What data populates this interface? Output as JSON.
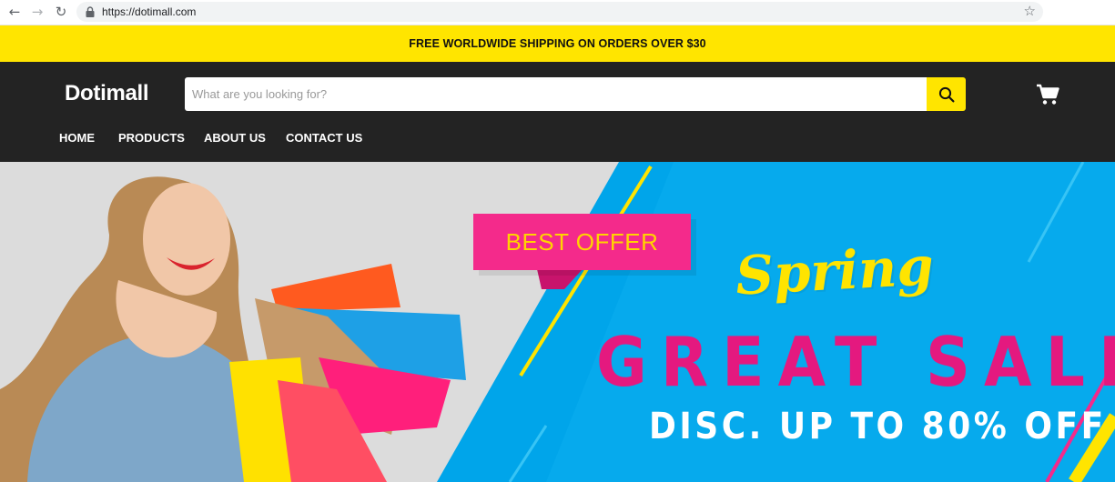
{
  "browser": {
    "url": "https://dotimall.com",
    "back_icon": "arrow-left-icon",
    "forward_icon": "arrow-right-icon",
    "reload_icon": "reload-icon",
    "lock_icon": "lock-icon",
    "star_icon": "star-icon"
  },
  "announcement": {
    "text": "FREE WORLDWIDE SHIPPING ON ORDERS OVER $30",
    "background": "#ffe500"
  },
  "header": {
    "logo": "Dotimall",
    "background": "#232323",
    "search": {
      "placeholder": "What are you looking for?",
      "value": "",
      "button_icon": "search-icon"
    },
    "cart_icon": "cart-icon"
  },
  "nav": {
    "items": [
      {
        "label": "HOME"
      },
      {
        "label": "PRODUCTS"
      },
      {
        "label": "ABOUT US"
      },
      {
        "label": "CONTACT US"
      }
    ]
  },
  "hero": {
    "badge": "BEST OFFER",
    "headline_script": "Spring",
    "headline": "GREAT SALE",
    "subline": "DISC. UP TO 80% OFF",
    "colors": {
      "blue": "#00a5ea",
      "pink": "#e4197f",
      "yellow": "#ffe400",
      "badge_pink": "#f42a8b"
    }
  }
}
